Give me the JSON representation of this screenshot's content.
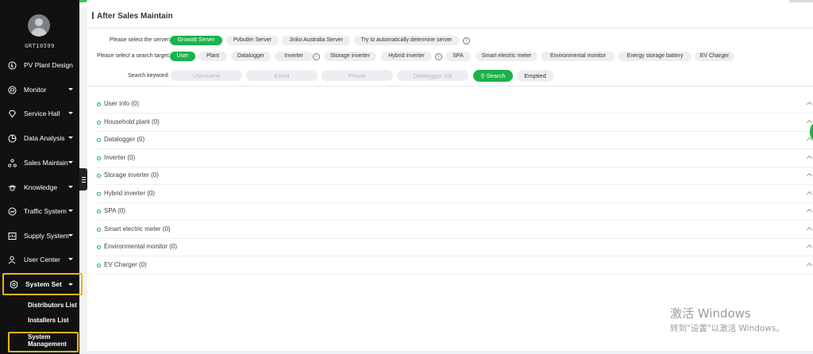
{
  "user": {
    "name": "GRT10599"
  },
  "sidebar": {
    "items": [
      {
        "label": "PV Plant Design",
        "icon": "pv-design-icon"
      },
      {
        "label": "Monitor",
        "icon": "monitor-icon"
      },
      {
        "label": "Service Hall",
        "icon": "service-hall-icon"
      },
      {
        "label": "Data Analysis",
        "icon": "data-analysis-icon"
      },
      {
        "label": "Sales Maintain",
        "icon": "sales-maintain-icon"
      },
      {
        "label": "Knowledge",
        "icon": "knowledge-icon"
      },
      {
        "label": "Traffic System",
        "icon": "traffic-system-icon"
      },
      {
        "label": "Supply System",
        "icon": "supply-system-icon"
      },
      {
        "label": "User Center",
        "icon": "user-center-icon"
      },
      {
        "label": "System Set",
        "icon": "system-set-icon"
      }
    ],
    "subitems": [
      {
        "label": "Distributors List"
      },
      {
        "label": "Installers List"
      },
      {
        "label": "System Management"
      }
    ]
  },
  "page": {
    "title": "After Sales Maintain"
  },
  "server": {
    "label": "Please select the server:",
    "options": [
      "Growatt Server",
      "Pvbutler Server",
      "Jinko Australia Server",
      "Try to automatically determine server"
    ],
    "selected": "Growatt Server"
  },
  "target": {
    "label": "Please select a search target:",
    "options": [
      "User",
      "Plant",
      "Datalogger",
      "Inverter",
      "Storage inverter",
      "Hybrid inverter",
      "SPA",
      "Smart electric meter",
      "Environmental monitor",
      "Energy storage battery",
      "EV Charger"
    ],
    "selected": "User"
  },
  "search": {
    "label": "Search keyword:",
    "placeholders": [
      "Username",
      "Email",
      "Phone",
      "Datalogger SN"
    ],
    "search_label": "Search",
    "empty_label": "Emptied"
  },
  "results": [
    {
      "label": "User info (0)"
    },
    {
      "label": "Household plant (0)"
    },
    {
      "label": "Datalogger (0)"
    },
    {
      "label": "Inverter (0)"
    },
    {
      "label": "Storage inverter (0)"
    },
    {
      "label": "Hybrid inverter (0)"
    },
    {
      "label": "SPA (0)"
    },
    {
      "label": "Smart electric meter (0)"
    },
    {
      "label": "Environmental monitor (0)"
    },
    {
      "label": "EV Charger (0)"
    }
  ],
  "watermark": {
    "line1": "激活 Windows",
    "line2": "转到\"设置\"以激活 Windows。"
  },
  "colors": {
    "accent": "#1cb34b",
    "highlight": "#f2b705",
    "sidebar": "#111111"
  }
}
